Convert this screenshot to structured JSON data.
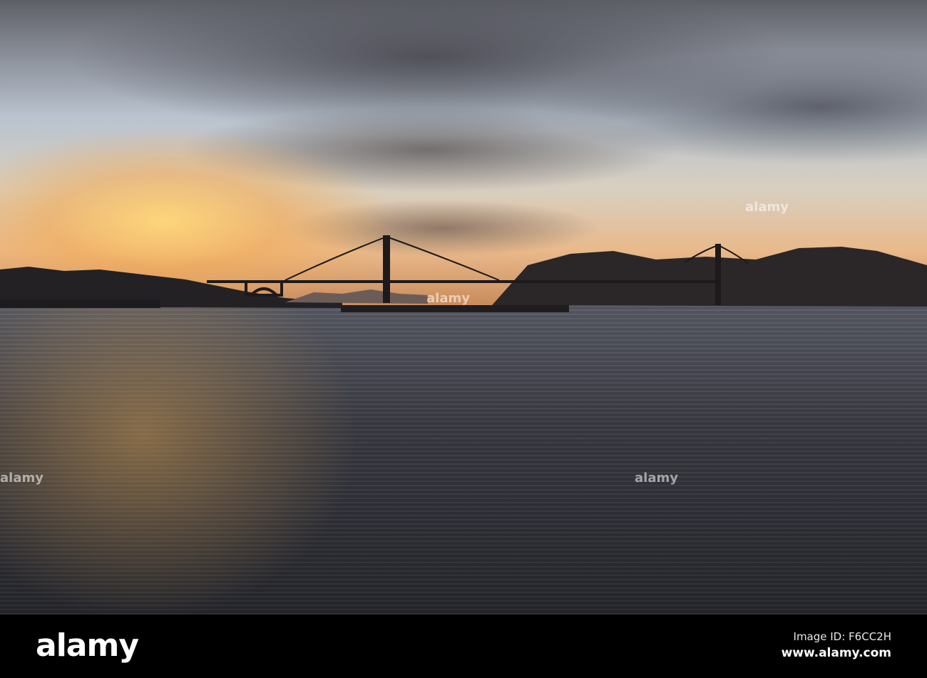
{
  "photo": {
    "subject": "Golden Gate Bridge at sunset over San Francisco Bay"
  },
  "watermark": {
    "logo_text": "alamy",
    "image_id": "Image ID: F6CC2H",
    "url": "www.alamy.com"
  }
}
